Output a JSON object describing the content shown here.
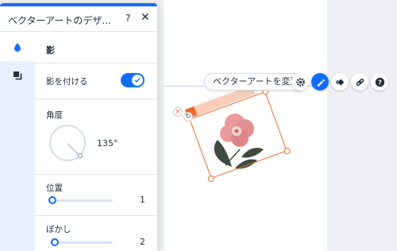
{
  "panel": {
    "title": "ベクターアートのデザ...",
    "help_label": "?",
    "close_label": "✕",
    "tabs": [
      {
        "name": "fill-tab",
        "icon": "droplet-icon",
        "active": true
      },
      {
        "name": "layers-tab",
        "icon": "layers-icon",
        "active": false
      }
    ],
    "section_title": "影",
    "shadow_toggle": {
      "label": "影を付ける",
      "on": true
    },
    "angle": {
      "label": "角度",
      "value": "135°"
    },
    "distance": {
      "label": "位置",
      "value": "1",
      "fraction": 0.02
    },
    "blur": {
      "label": "ぼかし",
      "value": "2",
      "fraction": 0.03
    }
  },
  "toolbar": {
    "change_vector_label": "ベクターアートを変更",
    "buttons": [
      {
        "name": "settings-button",
        "icon": "gear-icon"
      },
      {
        "name": "design-button",
        "icon": "brush-icon",
        "active": true
      },
      {
        "name": "animation-button",
        "icon": "animation-icon"
      },
      {
        "name": "link-button",
        "icon": "link-icon"
      },
      {
        "name": "help-button",
        "icon": "help-icon"
      }
    ]
  },
  "colors": {
    "accent": "#116dff",
    "selection": "#f26a2c",
    "panel_side": "#e7f0ff"
  }
}
